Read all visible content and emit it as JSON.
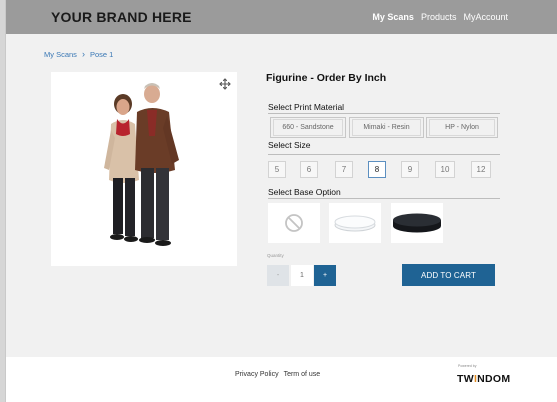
{
  "header": {
    "brand": "YOUR BRAND HERE",
    "nav": [
      {
        "label": "My Scans",
        "active": true
      },
      {
        "label": "Products",
        "active": false
      },
      {
        "label": "MyAccount",
        "active": false
      }
    ]
  },
  "breadcrumb": {
    "items": [
      "My Scans",
      "Pose 1"
    ]
  },
  "product": {
    "title": "Figurine - Order By Inch",
    "print_material_label": "Select Print Material",
    "materials": [
      "660 - Sandstone",
      "Mimaki - Resin",
      "HP - Nylon"
    ],
    "size_label": "Select Size",
    "sizes": [
      "5",
      "6",
      "7",
      "8",
      "9",
      "10",
      "12"
    ],
    "selected_size": "8",
    "base_label": "Select Base Option",
    "base_options": [
      "none-icon",
      "clear-base-icon",
      "black-base-icon"
    ],
    "quantity_label": "Quantity",
    "quantity": "1",
    "minus": "-",
    "plus": "+",
    "cart_label": "ADD TO CART"
  },
  "footer": {
    "privacy": "Privacy Policy",
    "terms": "Term of use",
    "powered_by": "Powered by",
    "logo_pre": "TW",
    "logo_i": "I",
    "logo_post": "NDOM"
  },
  "colors": {
    "accent": "#1f6394",
    "header_bg": "#9b9b9b",
    "link": "#3a78b5"
  }
}
